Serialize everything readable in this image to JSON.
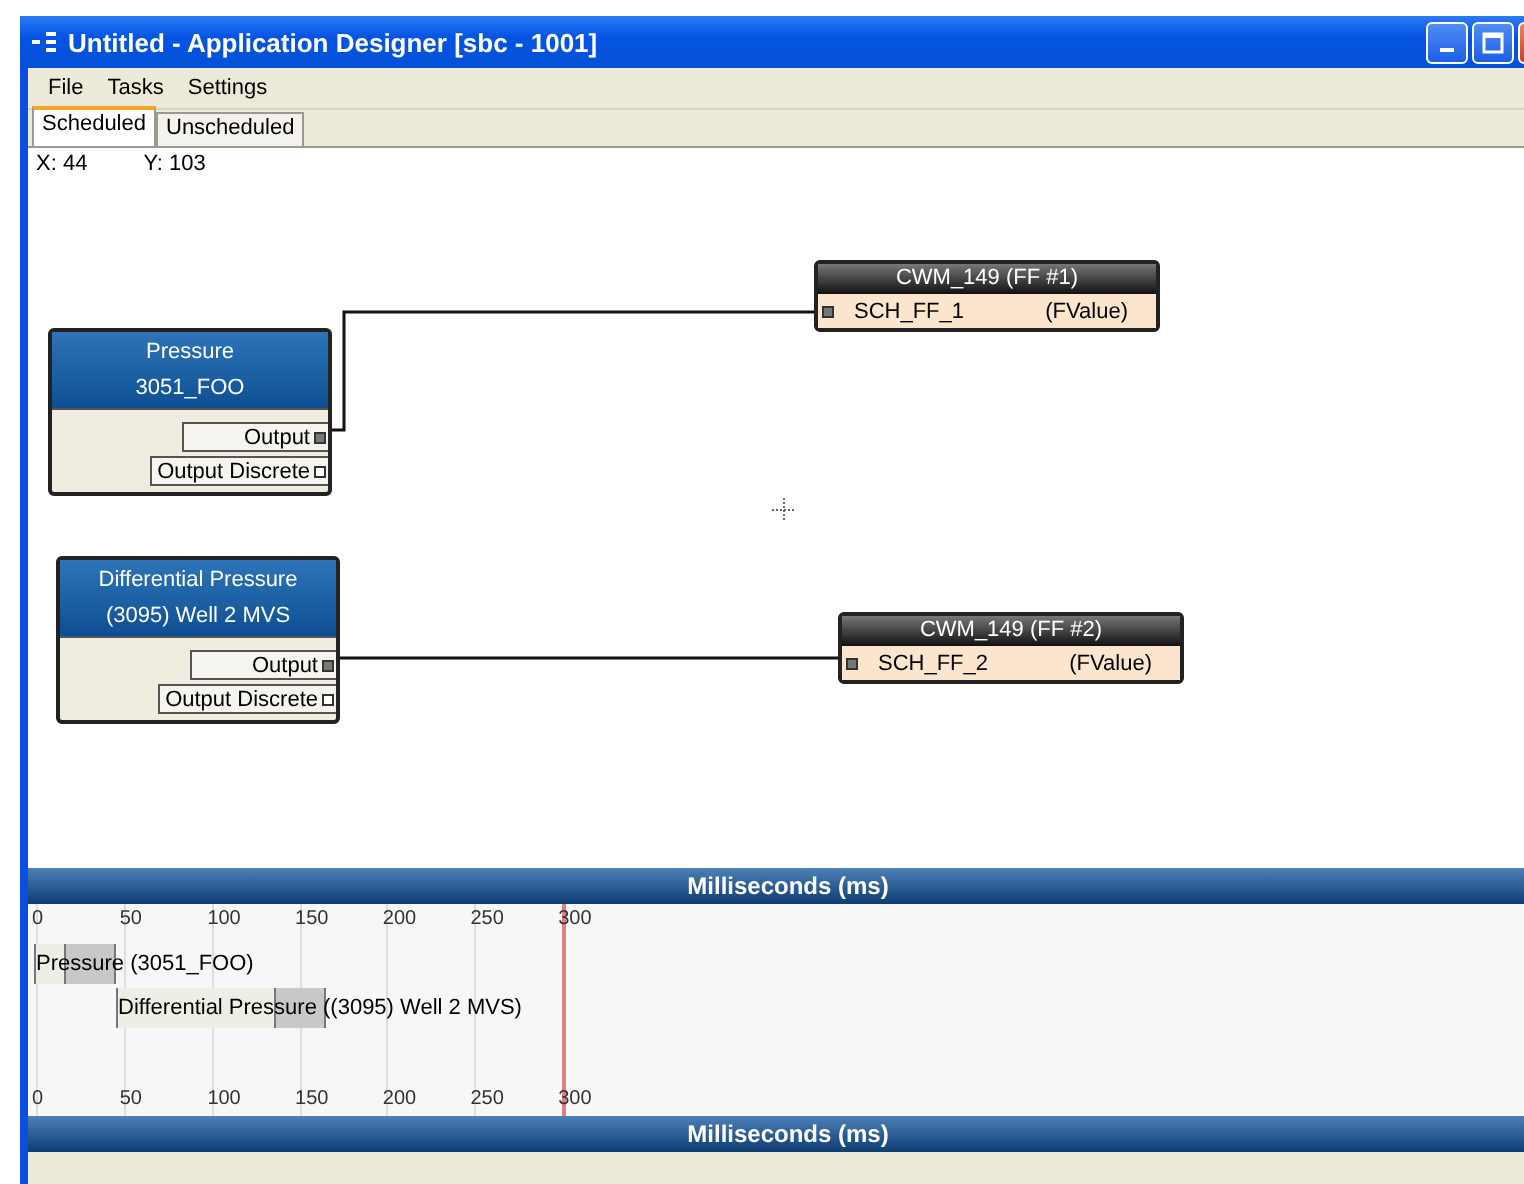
{
  "window": {
    "title": "Untitled - Application Designer [sbc - 1001]"
  },
  "menu": [
    "File",
    "Tasks",
    "Settings"
  ],
  "tabs": [
    {
      "label": "Scheduled",
      "selected": true
    },
    {
      "label": "Unscheduled",
      "selected": false
    }
  ],
  "coordinates": {
    "x": "X: 44",
    "y": "Y: 103"
  },
  "nodes": [
    {
      "kind": "device",
      "title": "Pressure",
      "subtitle": "3051_FOO",
      "ports": [
        "Output",
        "Output Discrete"
      ]
    },
    {
      "kind": "device",
      "title": "Differential Pressure",
      "subtitle": "(3095) Well 2 MVS",
      "ports": [
        "Output",
        "Output Discrete"
      ]
    },
    {
      "kind": "block",
      "title": "CWM_149 (FF #1)",
      "input": "SCH_FF_1",
      "type": "(FValue)"
    },
    {
      "kind": "block",
      "title": "CWM_149 (FF #2)",
      "input": "SCH_FF_2",
      "type": "(FValue)"
    }
  ],
  "timeline": {
    "header": "Milliseconds (ms)",
    "ticks": [
      "0",
      "50",
      "100",
      "150",
      "200",
      "250",
      "300"
    ],
    "bars": [
      {
        "label": "Pressure (3051_FOO)"
      },
      {
        "label": "Differential Pressure ((3095) Well 2 MVS)"
      }
    ],
    "bottom_ticks": [
      "0",
      "50",
      "100",
      "150",
      "200",
      "250",
      "300"
    ],
    "footer": "Milliseconds (ms)"
  }
}
